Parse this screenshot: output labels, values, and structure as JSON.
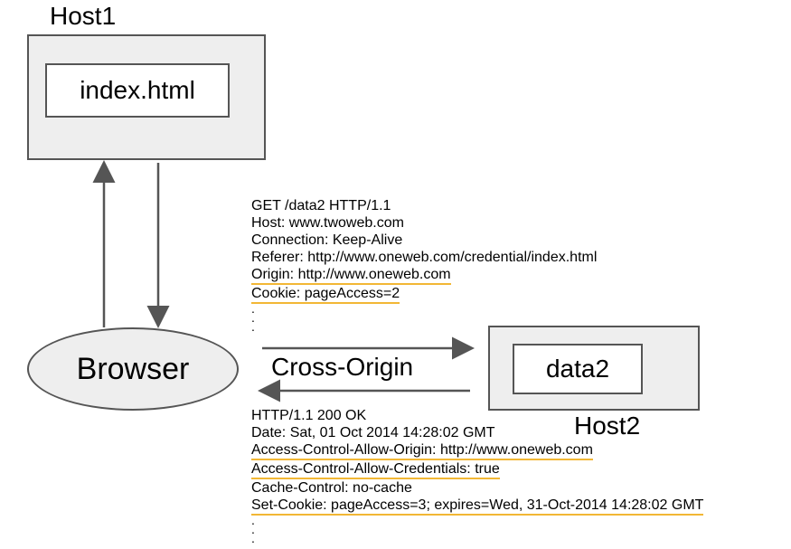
{
  "host1": {
    "title": "Host1",
    "file": "index.html"
  },
  "host2": {
    "title": "Host2",
    "file": "data2"
  },
  "browser": {
    "label": "Browser"
  },
  "arrows": {
    "cross_origin": "Cross-Origin"
  },
  "request": {
    "line1": "GET /data2 HTTP/1.1",
    "line2": "Host: www.twoweb.com",
    "line3": "Connection: Keep-Alive",
    "line4": "Referer: http://www.oneweb.com/credential/index.html",
    "line5": "Origin: http://www.oneweb.com",
    "line6": "Cookie: pageAccess=2"
  },
  "response": {
    "line1": "HTTP/1.1 200 OK",
    "line2": "Date: Sat, 01 Oct 2014 14:28:02 GMT",
    "line3": "Access-Control-Allow-Origin: http://www.oneweb.com",
    "line4": "Access-Control-Allow-Credentials: true",
    "line5": "Cache-Control: no-cache",
    "line6": "Set-Cookie: pageAccess=3; expires=Wed, 31-Oct-2014 14:28:02 GMT"
  }
}
